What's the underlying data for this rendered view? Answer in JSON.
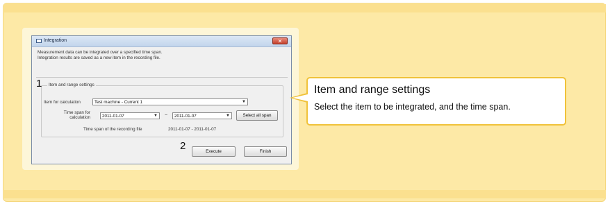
{
  "dialog": {
    "title": "Integration",
    "close_label": "✕",
    "description_line1": "Measurement data can be integrated over a specified time span.",
    "description_line2": "Integration results are saved as a new item in the recording file.",
    "step1_number": "1",
    "group_label": "Item and range settings",
    "item_label": "Item for calculation",
    "item_value": "Test machine - Current 1",
    "span_label_line1": "Time span for",
    "span_label_line2": "calculation",
    "start_date": "2011-01-07",
    "tilde": "~",
    "end_date": "2011-01-07",
    "select_all_label": "Select all span",
    "file_span_label": "Time span of the recording file",
    "file_span_value": "2011-01-07 - 2011-01-07",
    "step2_number": "2",
    "execute_label": "Execute",
    "finish_label": "Finish"
  },
  "callout": {
    "title": "Item and range settings",
    "body": "Select the item to be integrated, and the time span."
  },
  "colors": {
    "panel_background": "#fde9a6",
    "callout_border": "#f0c23a",
    "close_button": "#c4402c"
  },
  "icons": {
    "window": "window-icon",
    "close": "close-icon",
    "dropdown": "chevron-down-icon"
  }
}
